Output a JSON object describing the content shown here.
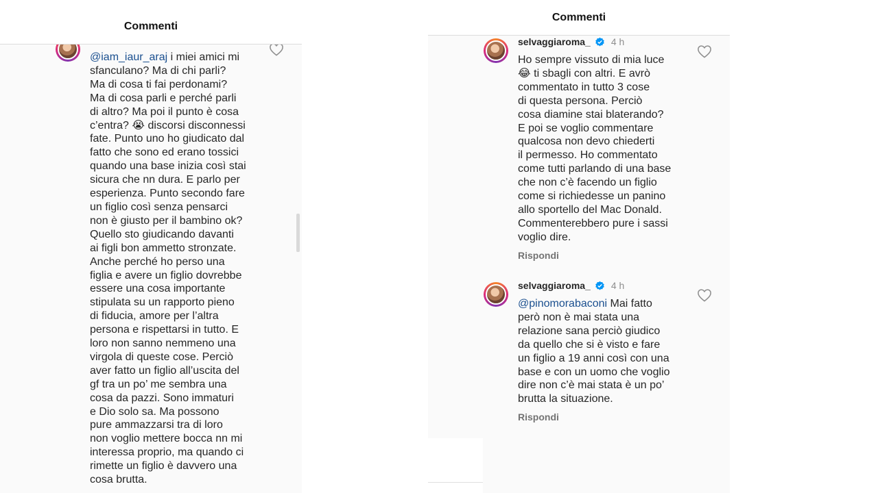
{
  "left": {
    "header_title": "Commenti",
    "mention": "@iam_iaur_araj",
    "text": " i miei amici mi\nsfanculano? Ma di chi parli?\nMa di cosa ti fai perdonami?\nMa di cosa parli e perché parli\ndi altro? Ma poi il punto è cosa\nc’entra? 😭 discorsi disconnessi\nfate. Punto uno ho giudicato dal\nfatto che sono ed erano tossici\nquando una base inizia così stai\nsicura che nn dura. E parlo per\nesperienza. Punto secondo fare\nun figlio così senza pensarci\nnon è giusto per il bambino ok?\nQuello sto giudicando davanti\nai figli bon ammetto stronzate.\nAnche perché ho perso una\nfiglia e avere un figlio dovrebbe\nessere una cosa importante\nstipulata su un rapporto pieno\ndi fiducia, amore per l’altra\npersona e rispettarsi in tutto. E\nloro non sanno nemmeno una\nvirgola di queste cose. Perciò\naver fatto un figlio all’uscita del\ngf tra un po’ me sembra una\ncosa da pazzi. Sono immaturi\ne Dio solo sa. Ma possono\npure ammazzarsi tra di loro\nnon voglio mettere bocca nn mi\ninteressa proprio, ma quando ci\nrimette un figlio è davvero una\ncosa brutta."
  },
  "right": {
    "header_title": "Commenti",
    "comments": [
      {
        "username": "selvaggiaroma_",
        "time": "4 h",
        "mention": "",
        "text": "Ho sempre vissuto di mia luce\n😂 ti sbagli con altri. E avrò\ncommentato in tutto 3 cose\ndi questa persona. Perciò\ncosa diamine stai blaterando?\nE poi se voglio commentare\nqualcosa non devo chiederti\nil permesso. Ho commentato\ncome tutti parlando di una base\nche non c’è facendo un figlio\ncome si richiedesse un panino\nallo sportello del Mac Donald.\nCommenterebbero pure i sassi\nvoglio dire.",
        "reply": "Rispondi"
      },
      {
        "username": "selvaggiaroma_",
        "time": "4 h",
        "mention": "@pinomorabaconi",
        "text": " Mai fatto\nperò non è mai stata una\nrelazione sana perciò giudico\nda quello che si è visto e fare\nun figlio a 19 anni così con una\nbase e con un uomo che voglio\ndire non c’è mai stata è un po’\nbrutta la situazione.",
        "reply": "Rispondi"
      }
    ]
  },
  "icons": [
    "heart-icon",
    "verified-badge-icon",
    "avatar"
  ],
  "colors": {
    "mention": "#1a4f8f",
    "verified": "#0095f6",
    "secondary_text": "#8e8e8e"
  }
}
